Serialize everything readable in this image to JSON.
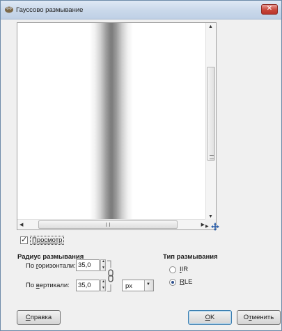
{
  "window": {
    "title": "Гауссово размывание",
    "close_label": "✕"
  },
  "preview": {
    "checkbox_label": "Просмотр",
    "checked": true
  },
  "radius": {
    "title": "Радиус размывания",
    "horizontal": {
      "label_pre": "По ",
      "label_u": "г",
      "label_post": "оризонтали:",
      "value": "35,0"
    },
    "vertical": {
      "label_pre": "По ",
      "label_u": "в",
      "label_post": "ертикали:",
      "value": "35,0"
    },
    "unit": "px"
  },
  "blur_type": {
    "title": "Тип размывания",
    "options": [
      {
        "u": "I",
        "rest": "IR",
        "selected": false
      },
      {
        "u": "R",
        "rest": "LE",
        "selected": true
      }
    ]
  },
  "buttons": {
    "help_u": "С",
    "help_rest": "правка",
    "ok_u": "O",
    "ok_rest": "K",
    "cancel_pre": "О",
    "cancel_u": "т",
    "cancel_rest": "менить"
  },
  "colors": {
    "title_bar": "#c9d8ea",
    "close_button": "#c9463a",
    "radio_selected": "#2b4e8c"
  }
}
